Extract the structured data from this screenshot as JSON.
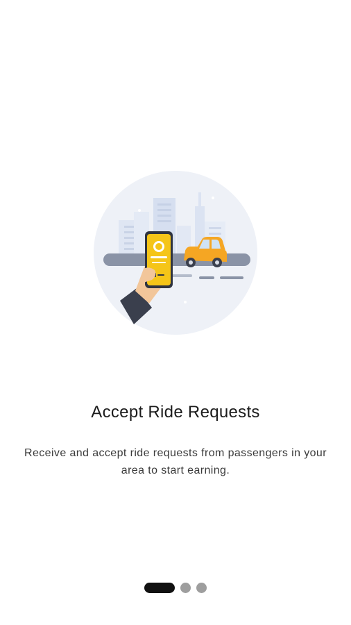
{
  "onboarding": {
    "illustration_icon": "hand-phone-taxi-city-illustration",
    "title": "Accept Ride Requests",
    "description": "Receive and accept ride requests from passengers in your area to start earning.",
    "pager": {
      "total_pages": 3,
      "current_page": 1
    }
  },
  "colors": {
    "background": "#ffffff",
    "title_text": "#1c1c1c",
    "description_text": "#3a3a3a",
    "illustration_circle": "#eef1f7",
    "phone_yellow": "#f5c518",
    "car_orange": "#f5a623",
    "pager_active": "#111111",
    "pager_inactive": "#9e9e9e"
  }
}
